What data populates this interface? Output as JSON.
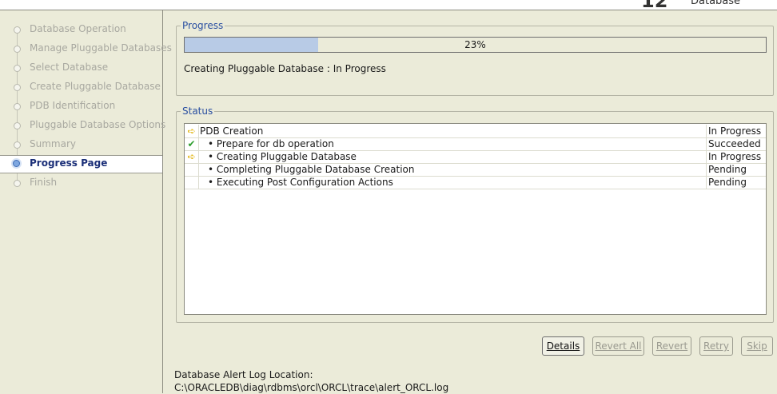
{
  "brand": {
    "version": "12",
    "product": "Database"
  },
  "steps": [
    {
      "label": "Database Operation"
    },
    {
      "label": "Manage Pluggable Databases"
    },
    {
      "label": "Select Database"
    },
    {
      "label": "Create Pluggable Database"
    },
    {
      "label": "PDB Identification"
    },
    {
      "label": "Pluggable Database Options"
    },
    {
      "label": "Summary"
    },
    {
      "label": "Progress Page"
    },
    {
      "label": "Finish"
    }
  ],
  "progress": {
    "legend": "Progress",
    "percent_text": "23%",
    "fraction": 0.23,
    "status_text": "Creating Pluggable Database : In Progress"
  },
  "status": {
    "legend": "Status",
    "rows": [
      {
        "icon": "in-progress-arrow-icon",
        "name": "PDB Creation",
        "state": "In Progress",
        "level": 0
      },
      {
        "icon": "succeeded-check-icon",
        "name": "Prepare for db operation",
        "state": "Succeeded",
        "level": 1
      },
      {
        "icon": "in-progress-arrow-icon",
        "name": "Creating Pluggable Database",
        "state": "In Progress",
        "level": 1
      },
      {
        "icon": "",
        "name": "Completing Pluggable Database Creation",
        "state": "Pending",
        "level": 1
      },
      {
        "icon": "",
        "name": "Executing Post Configuration Actions",
        "state": "Pending",
        "level": 1
      }
    ]
  },
  "buttons": {
    "details": "Details",
    "revert_all": "Revert All",
    "revert": "Revert",
    "retry": "Retry",
    "skip": "Skip"
  },
  "alert": {
    "label": "Database Alert Log Location:",
    "path": "C:\\ORACLEDB\\diag\\rdbms\\orcl\\ORCL\\trace\\alert_ORCL.log"
  },
  "colors": {
    "accent": "#2a4fa1",
    "progress_fill": "#b8cbe6",
    "active_step": "#1b2f78"
  }
}
